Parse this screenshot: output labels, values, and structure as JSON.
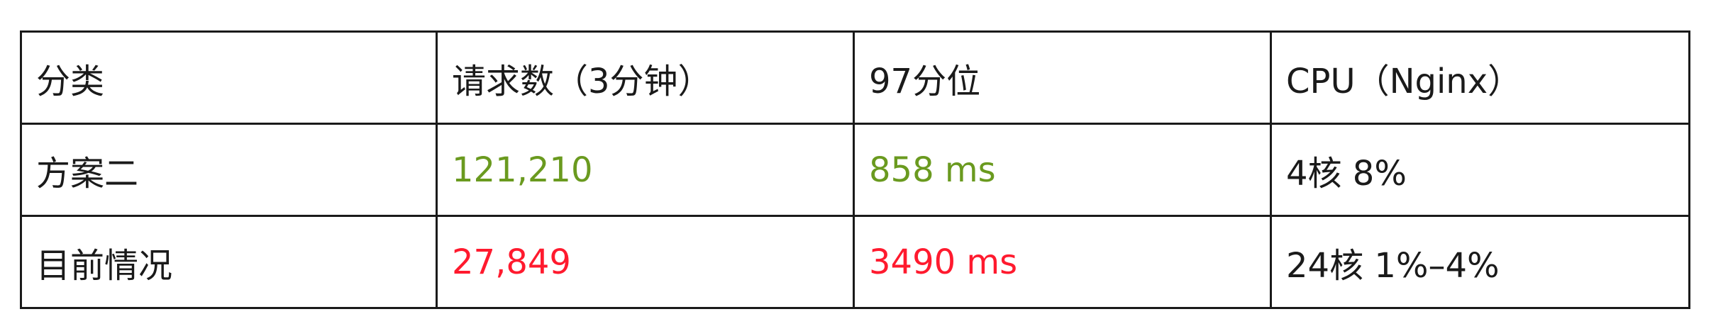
{
  "table": {
    "headers": [
      "分类",
      "请求数（3分钟）",
      "97分位",
      "CPU（Nginx）"
    ],
    "rows": [
      {
        "category": "方案二",
        "requests": "121,210",
        "p97": "858 ms",
        "cpu": "4核 8%"
      },
      {
        "category": "目前情况",
        "requests": "27,849",
        "p97": "3490 ms",
        "cpu": "24核 1%–4%"
      }
    ]
  },
  "colors": {
    "good": "#6a9a1f",
    "bad": "#ff1a2e",
    "text": "#1a1a1a",
    "border": "#1a1a1a"
  }
}
